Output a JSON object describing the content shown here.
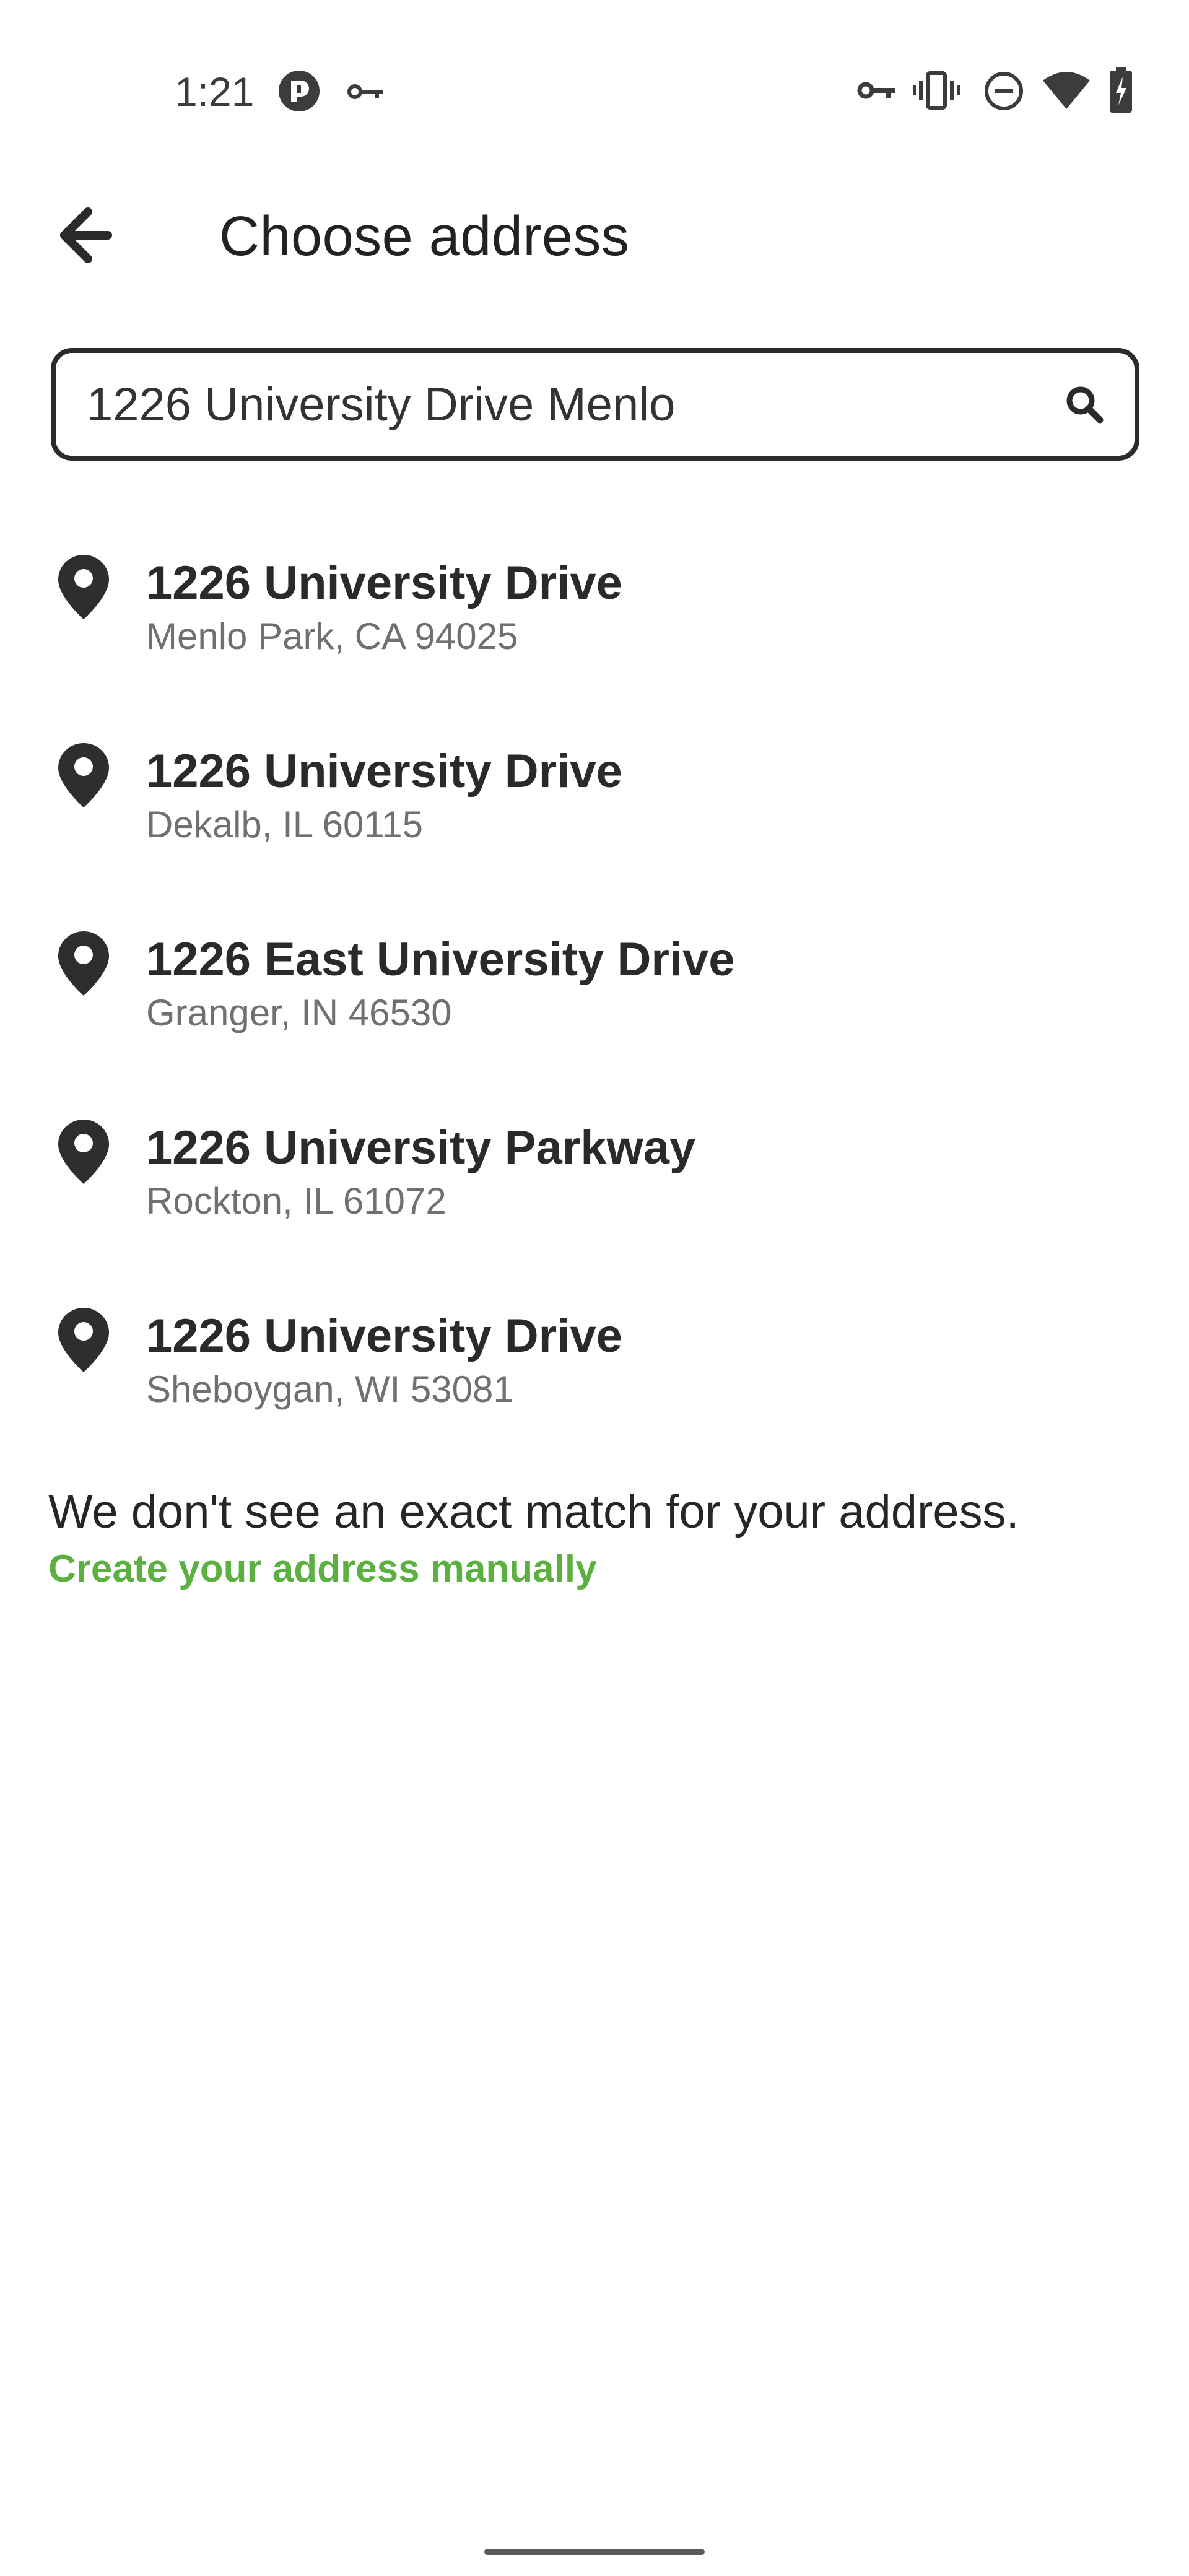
{
  "status_bar": {
    "time": "1:21",
    "left_icons": [
      "app-indicator-icon",
      "vpn-key-icon"
    ],
    "right_icons": [
      "vpn-key-icon",
      "vibrate-icon",
      "do-not-disturb-icon",
      "wifi-icon",
      "battery-charging-icon"
    ]
  },
  "header": {
    "back_icon": "arrow-back-icon",
    "title": "Choose address"
  },
  "search": {
    "value": "1226 University Drive Menlo",
    "icon": "search-icon"
  },
  "results": [
    {
      "line1": "1226 University Drive",
      "line2": "Menlo Park, CA 94025"
    },
    {
      "line1": "1226 University Drive",
      "line2": "Dekalb, IL 60115"
    },
    {
      "line1": "1226 East University Drive",
      "line2": "Granger, IN 46530"
    },
    {
      "line1": "1226 University Parkway",
      "line2": "Rockton, IL 61072"
    },
    {
      "line1": "1226 University Drive",
      "line2": "Sheboygan, WI 53081"
    }
  ],
  "no_match": {
    "message": "We don't see an exact match for your address.",
    "link": "Create your address manually"
  },
  "colors": {
    "link_green": "#5cb040",
    "text_dark": "#2a2a2a",
    "text_secondary": "#707070"
  }
}
